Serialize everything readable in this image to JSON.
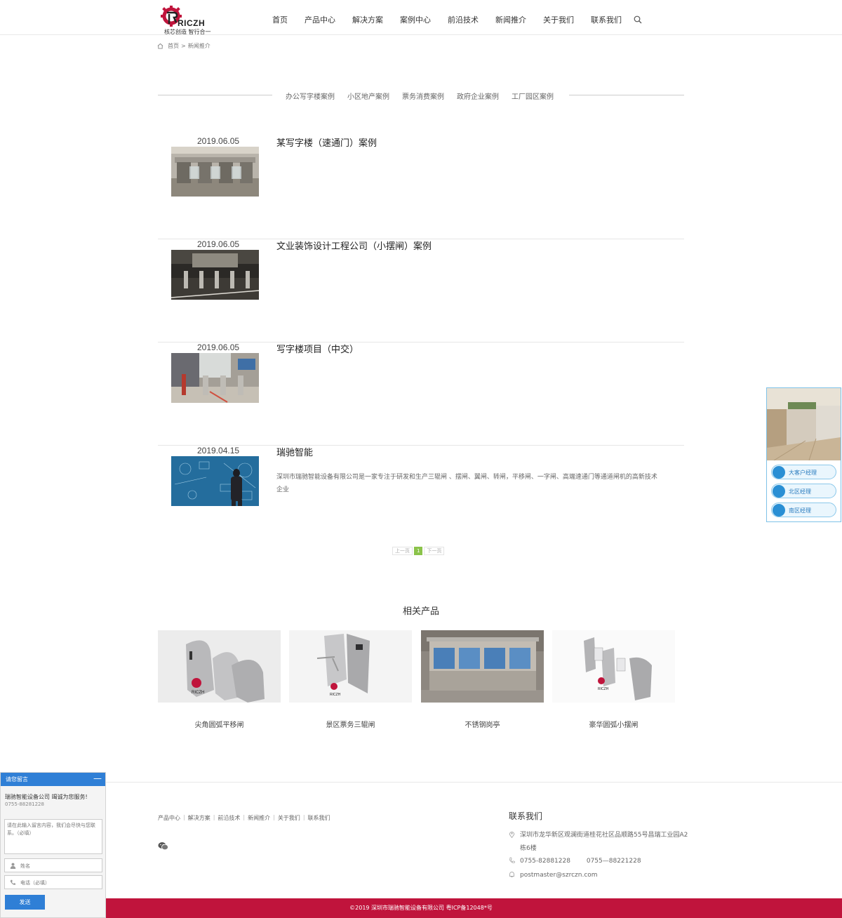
{
  "header": {
    "logo_text": "RICZH",
    "logo_slogan": "核芯创造  智行合一",
    "nav": [
      "首页",
      "产品中心",
      "解决方案",
      "案例中心",
      "前沿技术",
      "新闻推介",
      "关于我们",
      "联系我们"
    ]
  },
  "breadcrumb": {
    "home": "首页",
    "separator": ">",
    "current": "新闻推介"
  },
  "categories": [
    "办公写字楼案例",
    "小区地产案例",
    "票务消费案例",
    "政府企业案例",
    "工厂园区案例"
  ],
  "cases": [
    {
      "date": "2019.06.05",
      "title": "某写字楼（速通门）案例",
      "desc": ""
    },
    {
      "date": "2019.06.05",
      "title": "文业装饰设计工程公司（小摆闸）案例",
      "desc": ""
    },
    {
      "date": "2019.06.05",
      "title": "写字楼项目（中交）",
      "desc": ""
    },
    {
      "date": "2019.04.15",
      "title": "瑞驰智能",
      "desc": "深圳市瑞驰智能设备有限公司是一家专注于研发和生产三辊闸 、摆闸、翼闸、转闸，平移闸、一字闸、高端速通门等通道闸机的高新技术企业"
    }
  ],
  "pagination": {
    "prev": "上一页",
    "current": "1",
    "next": "下一页"
  },
  "related": {
    "title": "相关产品",
    "products": [
      "尖角圆弧平移闸",
      "景区票务三辊闸",
      "不锈钢岗亭",
      "豪华圆弧小摆闸"
    ]
  },
  "footer": {
    "links": [
      "产品中心",
      "解决方案",
      "前沿技术",
      "新闻推介",
      "关于我们",
      "联系我们"
    ],
    "contact_title": "联系我们",
    "address_line1": "深圳市龙华新区观澜街道桂花社区品顺路55号昌瑞工业园A2",
    "address_line2": "栋6楼",
    "phone": "0755-82881228        0755—88221228",
    "email": "postmaster@szrczn.com",
    "copyright": "©2019  深圳市瑞驰智能设备有限公司  粤ICP备12048*号"
  },
  "service": {
    "buttons": [
      "大客户经理",
      "北区经理",
      "南区经理"
    ]
  },
  "message": {
    "header": "请您留言",
    "minimize": "—",
    "company": "瑞驰智能设备公司 竭诚为您服务!",
    "phone": "0755-88281228",
    "textarea_placeholder": "请在此输入留言内容，我们会尽快与您联系。（必填）",
    "name_placeholder": "姓名",
    "phone_placeholder": "电话（必填）",
    "send": "发送"
  },
  "colors": {
    "footer_bar": "#c0143c",
    "accent_blue": "#2f7fd6",
    "pager_active": "#8bc34a"
  }
}
